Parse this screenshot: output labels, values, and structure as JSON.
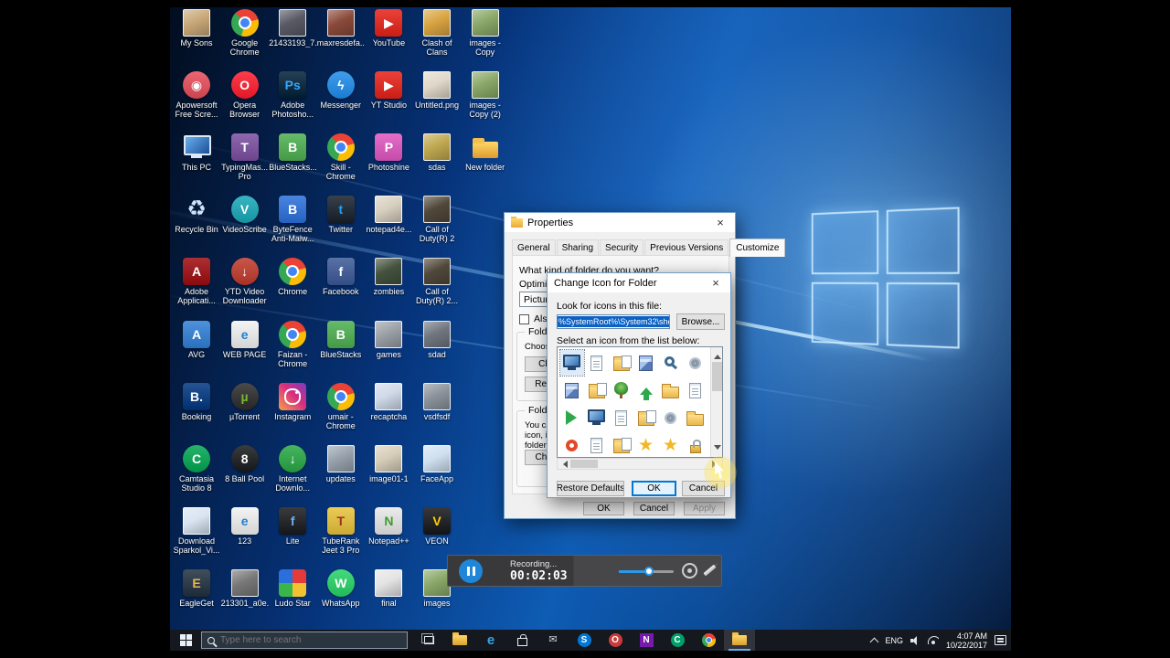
{
  "desktop": {
    "icons": [
      {
        "label": "My Sons",
        "kind": "img",
        "bg": "#c8a878",
        "col": 1,
        "row": 1
      },
      {
        "label": "Google Chrome",
        "kind": "chrome",
        "col": 2,
        "row": 1
      },
      {
        "label": "21433193_7...",
        "kind": "img",
        "bg": "#5a5a66",
        "col": 3,
        "row": 1
      },
      {
        "label": "maxresdefa...",
        "kind": "img",
        "bg": "#8a4a3a",
        "col": 4,
        "row": 1
      },
      {
        "label": "YouTube",
        "kind": "glyph",
        "bg": "#e62117",
        "fg": "#ffffff",
        "ch": "▶",
        "col": 5,
        "row": 1
      },
      {
        "label": "Clash of Clans",
        "kind": "img",
        "bg": "#d9a441",
        "col": 6,
        "row": 1
      },
      {
        "label": "images - Copy",
        "kind": "img",
        "bg": "#8aa868",
        "col": 7,
        "row": 1
      },
      {
        "label": "Apowersoft Free Scre...",
        "kind": "glyph",
        "bg": "#e84c5a",
        "fg": "#ffffff",
        "ch": "◉",
        "round": true,
        "col": 1,
        "row": 2
      },
      {
        "label": "Opera Browser",
        "kind": "glyph",
        "bg": "#ff1b2d",
        "fg": "#ffffff",
        "ch": "O",
        "round": true,
        "col": 2,
        "row": 2
      },
      {
        "label": "Adobe Photosho...",
        "kind": "glyph",
        "bg": "#001e36",
        "fg": "#31a8ff",
        "ch": "Ps",
        "col": 3,
        "row": 2
      },
      {
        "label": "Messenger",
        "kind": "glyph",
        "bg": "#1f8ceb",
        "fg": "#ffffff",
        "ch": "ϟ",
        "round": true,
        "col": 4,
        "row": 2
      },
      {
        "label": "YT Studio",
        "kind": "glyph",
        "bg": "#e62117",
        "fg": "#ffffff",
        "ch": "▶",
        "col": 5,
        "row": 2
      },
      {
        "label": "Untitled.png",
        "kind": "img",
        "bg": "#e0d8c8",
        "col": 6,
        "row": 2
      },
      {
        "label": "images - Copy (2)",
        "kind": "img",
        "bg": "#8aa868",
        "col": 7,
        "row": 2
      },
      {
        "label": "This PC",
        "kind": "pc",
        "col": 1,
        "row": 3
      },
      {
        "label": "TypingMas... Pro",
        "kind": "glyph",
        "bg": "#7b4ea0",
        "fg": "#ffffff",
        "ch": "T",
        "col": 2,
        "row": 3
      },
      {
        "label": "BlueStacks...",
        "kind": "glyph",
        "bg": "#4caf50",
        "fg": "#ffffff",
        "ch": "B",
        "col": 3,
        "row": 3
      },
      {
        "label": "Skill - Chrome",
        "kind": "chrome",
        "col": 4,
        "row": 3
      },
      {
        "label": "Photoshine",
        "kind": "glyph",
        "bg": "#e055c0",
        "fg": "#ffffff",
        "ch": "P",
        "col": 5,
        "row": 3
      },
      {
        "label": "sdas",
        "kind": "img",
        "bg": "#c0a850",
        "col": 6,
        "row": 3
      },
      {
        "label": "New folder",
        "kind": "folder",
        "col": 7,
        "row": 3
      },
      {
        "label": "Recycle Bin",
        "kind": "bin",
        "fg": "#cfe4fa",
        "ch": "♻",
        "col": 1,
        "row": 4
      },
      {
        "label": "VideoScribe",
        "kind": "glyph",
        "bg": "#18a8b8",
        "fg": "#ffffff",
        "ch": "V",
        "round": true,
        "col": 2,
        "row": 4
      },
      {
        "label": "ByteFence Anti-Malw...",
        "kind": "glyph",
        "bg": "#2a6fdb",
        "fg": "#ffffff",
        "ch": "B",
        "col": 3,
        "row": 4
      },
      {
        "label": "Twitter",
        "kind": "glyph",
        "bg": "#16202c",
        "fg": "#1da1f2",
        "ch": "t",
        "col": 4,
        "row": 4
      },
      {
        "label": "notepad4e...",
        "kind": "img",
        "bg": "#d8cfc0",
        "col": 5,
        "row": 4
      },
      {
        "label": "Call of Duty(R) 2 S...",
        "kind": "img",
        "bg": "#50483a",
        "col": 6,
        "row": 4
      },
      {
        "label": "Adobe Applicati...",
        "kind": "glyph",
        "bg": "#9e0b0f",
        "fg": "#ffffff",
        "ch": "A",
        "col": 1,
        "row": 5
      },
      {
        "label": "YTD Video Downloader",
        "kind": "glyph",
        "bg": "#c0392b",
        "fg": "#ffffff",
        "ch": "↓",
        "round": true,
        "col": 2,
        "row": 5
      },
      {
        "label": "Chrome",
        "kind": "chrome",
        "col": 3,
        "row": 5
      },
      {
        "label": "Facebook",
        "kind": "glyph",
        "bg": "#3b5998",
        "fg": "#ffffff",
        "ch": "f",
        "col": 4,
        "row": 5
      },
      {
        "label": "zombies",
        "kind": "img",
        "bg": "#44523e",
        "col": 5,
        "row": 5
      },
      {
        "label": "Call of Duty(R) 2...",
        "kind": "img",
        "bg": "#50483a",
        "col": 6,
        "row": 5
      },
      {
        "label": "AVG",
        "kind": "glyph",
        "bg": "#2f7fd6",
        "fg": "#ffffff",
        "ch": "A",
        "col": 1,
        "row": 6
      },
      {
        "label": "WEB PAGE",
        "kind": "glyph",
        "bg": "#f2f2f2",
        "fg": "#1d7fd6",
        "ch": "e",
        "col": 2,
        "row": 6
      },
      {
        "label": "Faizan - Chrome",
        "kind": "chrome",
        "col": 3,
        "row": 6
      },
      {
        "label": "BlueStacks",
        "kind": "glyph",
        "bg": "#4caf50",
        "fg": "#ffffff",
        "ch": "B",
        "col": 4,
        "row": 6
      },
      {
        "label": "games",
        "kind": "img",
        "bg": "#9aa0a6",
        "col": 5,
        "row": 6
      },
      {
        "label": "sdad",
        "kind": "img",
        "bg": "#707680",
        "col": 6,
        "row": 6
      },
      {
        "label": "Booking",
        "kind": "glyph",
        "bg": "#003580",
        "fg": "#ffffff",
        "ch": "B.",
        "col": 1,
        "row": 7
      },
      {
        "label": "µTorrent",
        "kind": "glyph",
        "bg": "#2b2b2b",
        "fg": "#76b82a",
        "ch": "µ",
        "round": true,
        "col": 2,
        "row": 7
      },
      {
        "label": "Instagram",
        "kind": "insta",
        "col": 3,
        "row": 7
      },
      {
        "label": "umair - Chrome",
        "kind": "chrome",
        "col": 4,
        "row": 7
      },
      {
        "label": "recaptcha",
        "kind": "img",
        "bg": "#d0d9e8",
        "col": 5,
        "row": 7
      },
      {
        "label": "vsdfsdf",
        "kind": "img",
        "bg": "#8c939c",
        "col": 6,
        "row": 7
      },
      {
        "label": "Camtasia Studio 8",
        "kind": "glyph",
        "bg": "#00a651",
        "fg": "#ffffff",
        "ch": "C",
        "round": true,
        "col": 1,
        "row": 8
      },
      {
        "label": "8 Ball Pool",
        "kind": "glyph",
        "bg": "#17191c",
        "fg": "#ffffff",
        "ch": "8",
        "round": true,
        "col": 2,
        "row": 8
      },
      {
        "label": "Internet Downlo...",
        "kind": "glyph",
        "bg": "#27a844",
        "fg": "#ffffff",
        "ch": "↓",
        "round": true,
        "col": 3,
        "row": 8
      },
      {
        "label": "updates",
        "kind": "img",
        "bg": "#98a2ad",
        "col": 4,
        "row": 8
      },
      {
        "label": "image01-1",
        "kind": "img",
        "bg": "#d6cdb8",
        "col": 5,
        "row": 8
      },
      {
        "label": "FaceApp",
        "kind": "img",
        "bg": "#cfe0f0",
        "col": 6,
        "row": 8
      },
      {
        "label": "Download Sparkol_Vi...",
        "kind": "img",
        "bg": "#d8e4f0",
        "col": 1,
        "row": 9
      },
      {
        "label": "123",
        "kind": "glyph",
        "bg": "#f2f2f2",
        "fg": "#1d7fd6",
        "ch": "e",
        "col": 2,
        "row": 9
      },
      {
        "label": "Lite",
        "kind": "glyph",
        "bg": "#18191d",
        "fg": "#6ab0f3",
        "ch": "f",
        "col": 3,
        "row": 9
      },
      {
        "label": "TubeRank Jeet 3 Pro",
        "kind": "glyph",
        "bg": "#e8c23a",
        "fg": "#a03020",
        "ch": "T",
        "col": 4,
        "row": 9
      },
      {
        "label": "Notepad++",
        "kind": "glyph",
        "bg": "#e8e8e8",
        "fg": "#3f9b2f",
        "ch": "N",
        "col": 5,
        "row": 9
      },
      {
        "label": "VEON",
        "kind": "glyph",
        "bg": "#15161a",
        "fg": "#ffcf00",
        "ch": "V",
        "col": 6,
        "row": 9
      },
      {
        "label": "EagleGet",
        "kind": "glyph",
        "bg": "#203040",
        "fg": "#e8b64c",
        "ch": "E",
        "col": 1,
        "row": 10
      },
      {
        "label": "213301_a0e...",
        "kind": "img",
        "bg": "#787878",
        "col": 2,
        "row": 10
      },
      {
        "label": "Ludo Star",
        "kind": "ludo",
        "col": 3,
        "row": 10
      },
      {
        "label": "WhatsApp",
        "kind": "glyph",
        "bg": "#25d366",
        "fg": "#ffffff",
        "ch": "W",
        "round": true,
        "col": 4,
        "row": 10
      },
      {
        "label": "final",
        "kind": "img",
        "bg": "#e4e4e4",
        "col": 5,
        "row": 10
      },
      {
        "label": "images",
        "kind": "img",
        "bg": "#8aa868",
        "col": 6,
        "row": 10
      }
    ]
  },
  "properties_dialog": {
    "title": "Properties",
    "tabs": [
      "General",
      "Sharing",
      "Security",
      "Previous Versions",
      "Customize"
    ],
    "question": "What kind of folder do you want?",
    "optimize_label": "Optimize this folder for:",
    "optimize_value": "Pictures",
    "also_apply_label": "Also apply this template to all subfolders",
    "folder_pictures_group": "Folder pictures",
    "folder_pictures_text": "Choose a file to show on this folder icon.",
    "choose_file_button": "Choose File...",
    "restore_default_button": "Restore Default",
    "folder_icons_group": "Folder icons",
    "folder_icons_text": "You can change the folder icon. If you change the icon, it will no longer show a preview of the folder's contents.",
    "change_icon_button": "Change Icon...",
    "ok_button": "OK",
    "cancel_button": "Cancel",
    "apply_button": "Apply",
    "close_glyph": "×"
  },
  "change_icon_dialog": {
    "title": "Change Icon for  Folder",
    "look_label": "Look for icons in this file:",
    "path_value": "%SystemRoot%\\System32\\shell32.dll",
    "browse_button": "Browse...",
    "select_label": "Select an icon from the list below:",
    "icons": [
      "monitor",
      "doc",
      "folderdoc",
      "box",
      "search",
      "gear",
      "box",
      "folderdoc",
      "tree",
      "arrowup",
      "folder",
      "doc",
      "share",
      "monitor",
      "doc",
      "folderdoc",
      "gear",
      "folder",
      "circle",
      "doc",
      "folderdoc",
      "star",
      "star",
      "lock"
    ],
    "selected_index": 0,
    "restore_defaults_button": "Restore Defaults",
    "ok_button": "OK",
    "cancel_button": "Cancel",
    "close_glyph": "×"
  },
  "recorder": {
    "status": "Recording...",
    "time": "00:02:03"
  },
  "taskbar": {
    "search_placeholder": "Type here to search",
    "apps": [
      {
        "kind": "taskview"
      },
      {
        "kind": "explorer"
      },
      {
        "kind": "letter",
        "ch": "e",
        "fg": "#35a3e8",
        "size": 15
      },
      {
        "kind": "store"
      },
      {
        "kind": "letter",
        "ch": "✉",
        "fg": "#cfd8e0",
        "size": 11
      },
      {
        "kind": "letter",
        "ch": "S",
        "fg": "#ffffff",
        "bg": "#0078d7",
        "round": true
      },
      {
        "kind": "letter",
        "ch": "O",
        "fg": "#ffffff",
        "bg": "#cc3b3b",
        "round": true
      },
      {
        "kind": "letter",
        "ch": "N",
        "fg": "#ffffff",
        "bg": "#7719aa"
      },
      {
        "kind": "letter",
        "ch": "C",
        "fg": "#ffffff",
        "bg": "#00a06a",
        "round": true
      },
      {
        "kind": "chrome"
      },
      {
        "kind": "explorer",
        "active": true
      }
    ],
    "tray": {
      "lang": "ENG",
      "time": "4:07 AM",
      "date": "10/22/2017"
    }
  }
}
